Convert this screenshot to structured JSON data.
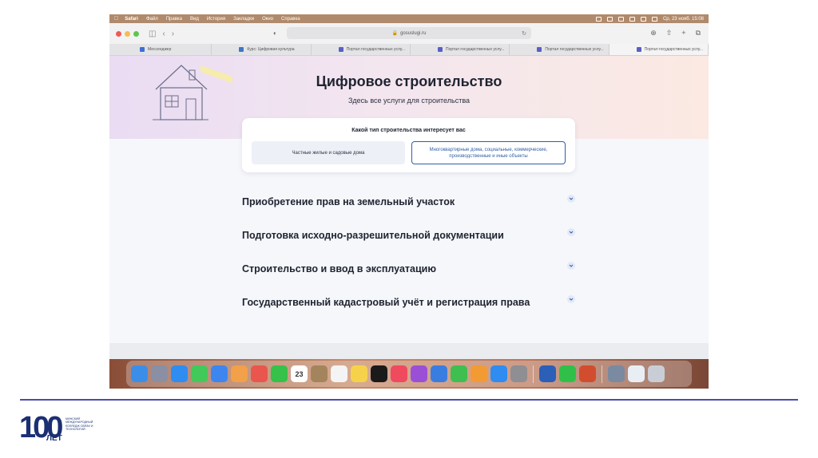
{
  "menubar": {
    "app": "Safari",
    "items": [
      "Файл",
      "Правка",
      "Вид",
      "История",
      "Закладки",
      "Окно",
      "Справка"
    ],
    "clock": "Ср, 23 нояб. 15:08"
  },
  "browser": {
    "address": "gosuslugi.ru",
    "tabs": [
      {
        "label": "Мессенджер",
        "color": "#3d6fd6"
      },
      {
        "label": "Курс: Цифровая культура",
        "color": "#3b78c2"
      },
      {
        "label": "Портал государственных услу...",
        "color": "#5a5fc4"
      },
      {
        "label": "Портал государственных услу...",
        "color": "#5a5fc4"
      },
      {
        "label": "Портал государственных услу...",
        "color": "#5a5fc4"
      },
      {
        "label": "Портал государственных услу...",
        "color": "#5a5fc4"
      }
    ]
  },
  "page": {
    "title": "Цифровое строительство",
    "subtitle": "Здесь все услуги для строительства",
    "type_card": {
      "question": "Какой тип строительства интересует вас",
      "option_private": "Частные жилые и садовые дома",
      "option_multi": "Многоквартирные дома, социальные, коммерческие, производственные и иные объекты"
    },
    "sections": [
      "Приобретение прав на земельный участок",
      "Подготовка исходно-разрешительной документации",
      "Строительство и ввод в эксплуатацию",
      "Государственный кадастровый учёт и регистрация права"
    ]
  },
  "dock": {
    "calendar_day": "23",
    "icons": [
      {
        "name": "finder-icon",
        "color": "#3b8ee8"
      },
      {
        "name": "launchpad-icon",
        "color": "#8a8fa3"
      },
      {
        "name": "safari-icon",
        "color": "#2f8cf0"
      },
      {
        "name": "messages-icon",
        "color": "#41c95a"
      },
      {
        "name": "mail-icon",
        "color": "#3d86f0"
      },
      {
        "name": "photos-icon",
        "color": "#f2a04a"
      },
      {
        "name": "photos-app-icon",
        "color": "#e8564d"
      },
      {
        "name": "facetime-icon",
        "color": "#35c14a"
      },
      {
        "name": "calendar-icon",
        "color": "#ffffff"
      },
      {
        "name": "notes-brown-icon",
        "color": "#a4845c"
      },
      {
        "name": "reminders-icon",
        "color": "#f4f4f4"
      },
      {
        "name": "notes-icon",
        "color": "#f6d24a"
      },
      {
        "name": "appletv-icon",
        "color": "#1a1a1a"
      },
      {
        "name": "music-icon",
        "color": "#f04a5e"
      },
      {
        "name": "podcasts-icon",
        "color": "#9b4fd6"
      },
      {
        "name": "keynote-icon",
        "color": "#3a7de0"
      },
      {
        "name": "numbers-icon",
        "color": "#3fbf4f"
      },
      {
        "name": "pages-icon",
        "color": "#f29b35"
      },
      {
        "name": "appstore-icon",
        "color": "#2f8cf0"
      },
      {
        "name": "settings-icon",
        "color": "#8e8e93"
      },
      {
        "name": "word-icon",
        "color": "#2b5fb8"
      },
      {
        "name": "whatsapp-icon",
        "color": "#30c04a"
      },
      {
        "name": "powerpoint-icon",
        "color": "#d24d2e"
      },
      {
        "name": "preview-icon",
        "color": "#7a8aa0"
      },
      {
        "name": "mail-doc-icon",
        "color": "#e9eef5"
      },
      {
        "name": "trash-icon",
        "color": "#c9ced6"
      }
    ]
  },
  "logo": {
    "number": "100",
    "years": "ЛЕТ",
    "caption": "МИНСКИЙ МЕЖДУНАРОДНЫЙ КОЛЛЕДЖ СВЯЗИ И ТЕХНОЛОГИЙ"
  }
}
